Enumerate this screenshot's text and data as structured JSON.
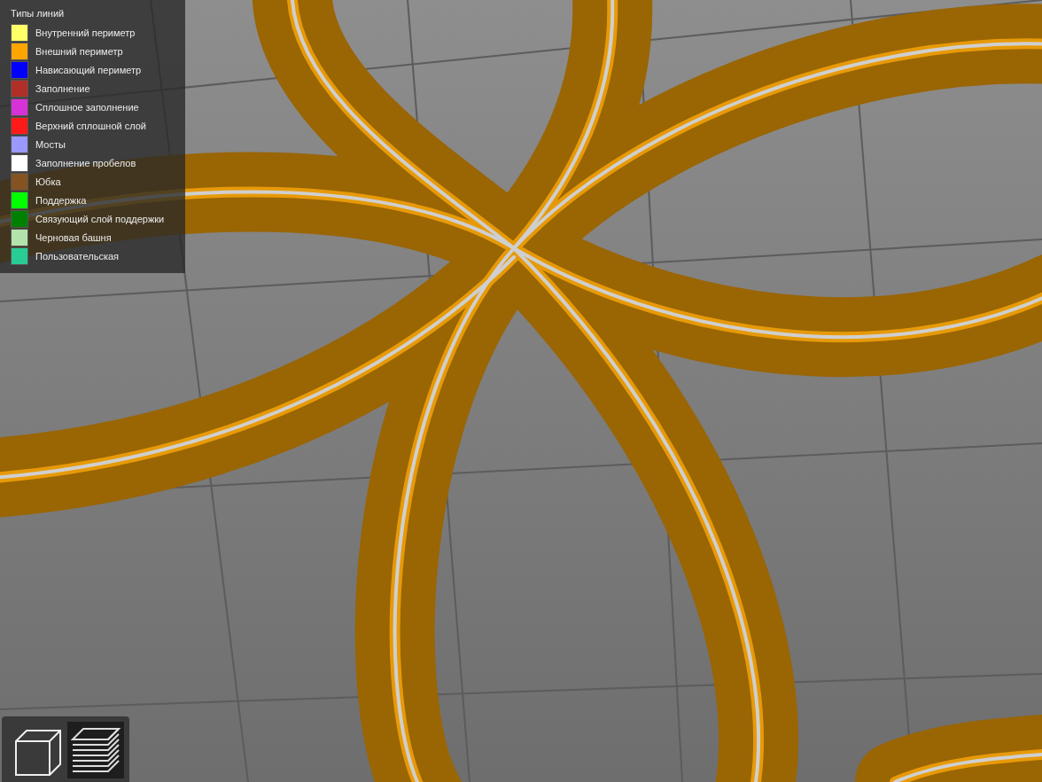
{
  "legend": {
    "title": "Типы линий",
    "items": [
      {
        "label": "Внутренний периметр",
        "color": "#ffff68"
      },
      {
        "label": "Внешний периметр",
        "color": "#ffa500"
      },
      {
        "label": "Нависающий периметр",
        "color": "#0000ff"
      },
      {
        "label": "Заполнение",
        "color": "#b03029"
      },
      {
        "label": "Сплошное заполнение",
        "color": "#d732d7"
      },
      {
        "label": "Верхний сплошной слой",
        "color": "#ff1a1a"
      },
      {
        "label": "Мосты",
        "color": "#9999ff"
      },
      {
        "label": "Заполнение пробелов",
        "color": "#ffffff"
      },
      {
        "label": "Юбка",
        "color": "#845321"
      },
      {
        "label": "Поддержка",
        "color": "#00ff00"
      },
      {
        "label": "Связующий слой поддержки",
        "color": "#008000"
      },
      {
        "label": "Черновая башня",
        "color": "#b3e3ab"
      },
      {
        "label": "Пользовательская",
        "color": "#28cc94"
      }
    ]
  },
  "view_toolbar": [
    {
      "kind": "model",
      "selected": false
    },
    {
      "kind": "preview",
      "selected": true
    }
  ]
}
